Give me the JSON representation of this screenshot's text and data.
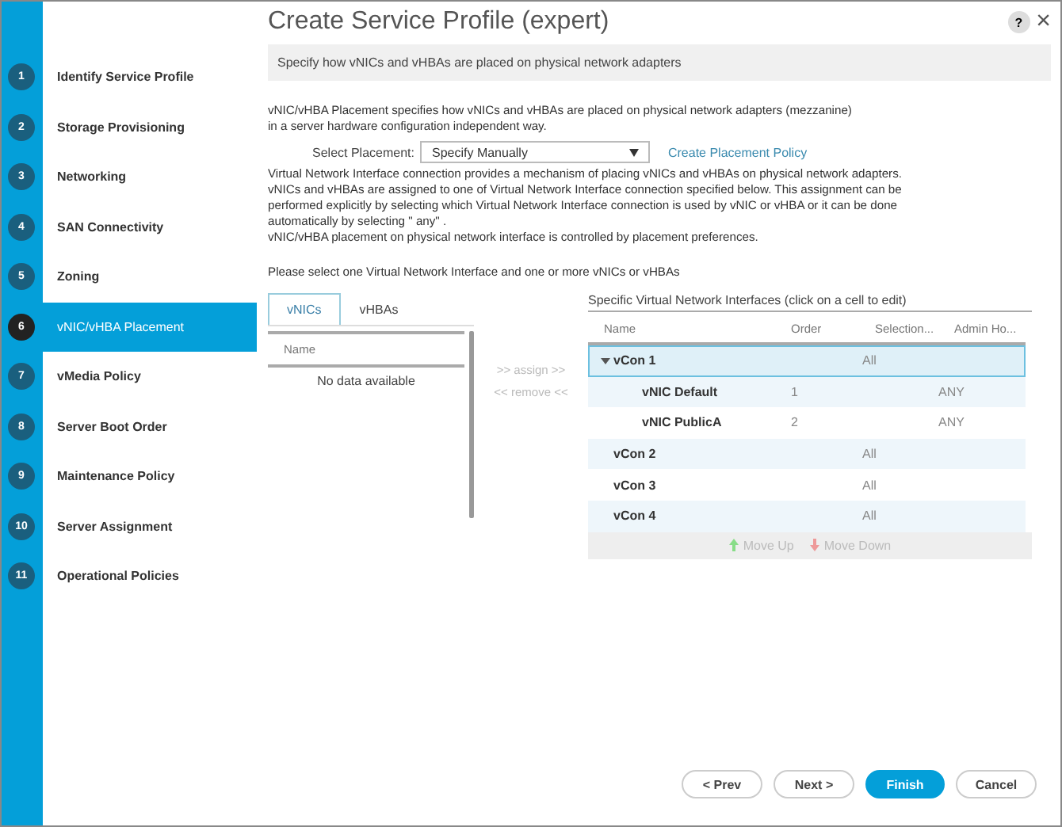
{
  "window": {
    "title": "Create Service Profile (expert)",
    "help": "?",
    "close": "×"
  },
  "steps": [
    {
      "number": "1",
      "label": "Identify Service Profile",
      "selected": false
    },
    {
      "number": "2",
      "label": "Storage Provisioning",
      "selected": false
    },
    {
      "number": "3",
      "label": "Networking",
      "selected": false
    },
    {
      "number": "4",
      "label": "SAN Connectivity",
      "selected": false
    },
    {
      "number": "5",
      "label": "Zoning",
      "selected": false
    },
    {
      "number": "6",
      "label": "vNIC/vHBA Placement",
      "selected": true
    },
    {
      "number": "7",
      "label": "vMedia Policy",
      "selected": false
    },
    {
      "number": "8",
      "label": "Server Boot Order",
      "selected": false
    },
    {
      "number": "9",
      "label": "Maintenance Policy",
      "selected": false
    },
    {
      "number": "10",
      "label": "Server Assignment",
      "selected": false
    },
    {
      "number": "11",
      "label": "Operational Policies",
      "selected": false
    }
  ],
  "banner": "Specify how vNICs and vHBAs are placed on physical network adapters",
  "intro": [
    "vNIC/vHBA Placement specifies how vNICs and vHBAs are placed on physical network adapters (mezzanine)",
    "in a server hardware configuration independent way."
  ],
  "placement": {
    "label": "Select Placement:",
    "value": "Specify Manually",
    "link": "Create Placement Policy"
  },
  "explanation": [
    "Virtual Network Interface connection provides a mechanism of placing vNICs and vHBAs on physical network adapters.",
    "vNICs and vHBAs are assigned to one of Virtual Network Interface connection specified below. This assignment can be",
    "performed explicitly by selecting which Virtual Network Interface connection is used by vNIC or vHBA or it can be done",
    "automatically by selecting \" any\" .",
    "vNIC/vHBA placement on physical network interface is controlled by placement preferences."
  ],
  "instruction": "Please select one Virtual Network Interface and one or more vNICs or vHBAs",
  "adapter_tabs": [
    {
      "label": "vNICs",
      "selected": true
    },
    {
      "label": "vHBAs",
      "selected": false
    }
  ],
  "adapter_list": {
    "columns": [
      "Name"
    ],
    "empty": "No data available"
  },
  "assign": ">> assign >>",
  "remove": "<< remove <<",
  "interfaces": {
    "title": "Specific Virtual Network Interfaces (click on a cell to edit)",
    "columns": [
      "Name",
      "Order",
      "Selection...",
      "Admin Ho..."
    ],
    "rows": [
      {
        "name": "vCon 1",
        "selection": "All",
        "expanded": true,
        "selected": true,
        "children": [
          {
            "name": "vNIC Default",
            "order": "1",
            "admin_host": "ANY"
          },
          {
            "name": "vNIC PublicA",
            "order": "2",
            "admin_host": "ANY"
          }
        ]
      },
      {
        "name": "vCon 2",
        "selection": "All",
        "expanded": false,
        "selected": false
      },
      {
        "name": "vCon 3",
        "selection": "All",
        "expanded": false,
        "selected": false
      },
      {
        "name": "vCon 4",
        "selection": "All",
        "expanded": false,
        "selected": false
      }
    ],
    "move_up": "Move Up",
    "move_down": "Move Down"
  },
  "buttons": [
    {
      "label": "< Prev",
      "primary": false
    },
    {
      "label": "Next >",
      "primary": false
    },
    {
      "label": "Finish",
      "primary": true
    },
    {
      "label": "Cancel",
      "primary": false
    }
  ]
}
